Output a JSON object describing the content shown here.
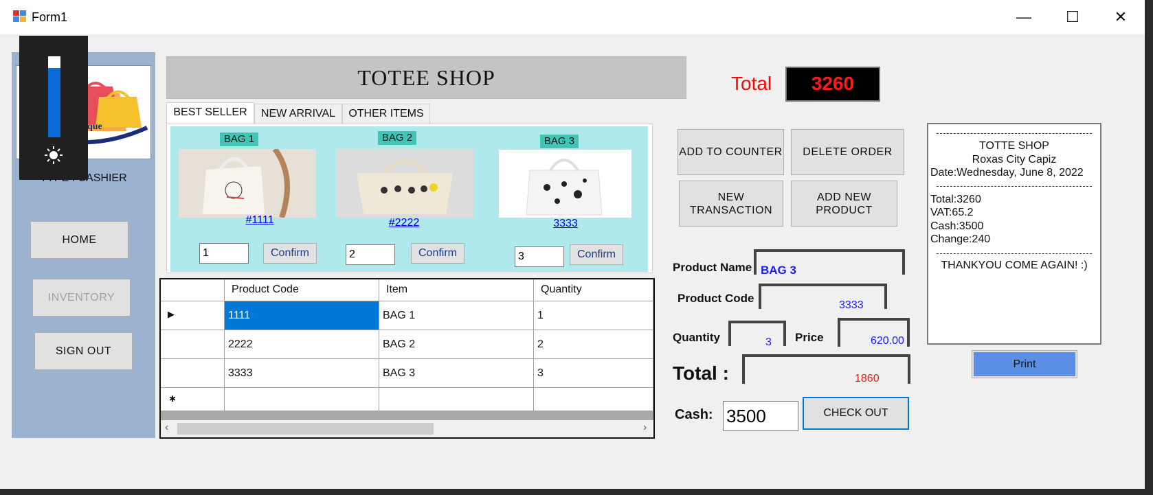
{
  "window": {
    "title": "Form1",
    "minimize_glyph": "—",
    "maximize_glyph": "☐",
    "close_glyph": "✕"
  },
  "sidebar": {
    "logo_text": "Tote Bag Boutique",
    "user_type": "TYPE : CASHIER",
    "buttons": {
      "home": "HOME",
      "inventory": "INVENTORY",
      "signout": "SIGN OUT"
    }
  },
  "brightness": {
    "icon": "sun-icon",
    "level": 0.86
  },
  "header": {
    "title": "TOTEE SHOP"
  },
  "tabs": [
    "BEST SELLER",
    "NEW ARRIVAL",
    "OTHER ITEMS"
  ],
  "products": [
    {
      "label": "BAG 1",
      "link": "#1111",
      "qty": "1",
      "confirm": "Confirm"
    },
    {
      "label": "BAG 2",
      "link": "#2222",
      "qty": "2",
      "confirm": "Confirm"
    },
    {
      "label": "BAG 3",
      "link": "3333",
      "qty": "3",
      "confirm": "Confirm"
    }
  ],
  "grid": {
    "columns": [
      "Product Code",
      "Item",
      "Quantity"
    ],
    "rows": [
      {
        "code": "1111",
        "item": "BAG 1",
        "qty": "1"
      },
      {
        "code": "2222",
        "item": "BAG 2",
        "qty": "2"
      },
      {
        "code": "3333",
        "item": "BAG 3",
        "qty": "3"
      }
    ],
    "current_marker": "▶",
    "new_marker": "✱",
    "scroll_left": "‹",
    "scroll_right": "›"
  },
  "total": {
    "label": "Total",
    "value": "3260"
  },
  "actions": {
    "add_counter": "ADD TO COUNTER",
    "delete_order": "DELETE ORDER",
    "new_transaction": "NEW TRANSACTION",
    "add_product": "ADD NEW PRODUCT"
  },
  "form": {
    "product_name_label": "Product Name",
    "product_name": "BAG 3",
    "product_code_label": "Product Code",
    "product_code": "3333",
    "quantity_label": "Quantity",
    "quantity": "3",
    "price_label": "Price",
    "price": "620.00",
    "total_label": "Total :",
    "total": "1860",
    "cash_label": "Cash:",
    "cash": "3500",
    "checkout": "CHECK OUT"
  },
  "receipt": {
    "shop": "TOTTE SHOP",
    "location": "Roxas City Capiz",
    "date": "Date:Wednesday, June 8, 2022",
    "total": "Total:3260",
    "vat": "VAT:65.2",
    "cash": "Cash:3500",
    "change": "Change:240",
    "thanks": "THANKYOU COME AGAIN! :)"
  },
  "print": {
    "label": "Print"
  },
  "colors": {
    "accent_blue": "#0078d7",
    "total_red": "#ff0000",
    "tab_bg": "#afe9ec",
    "sidebar_bg": "#9bb3d1"
  }
}
